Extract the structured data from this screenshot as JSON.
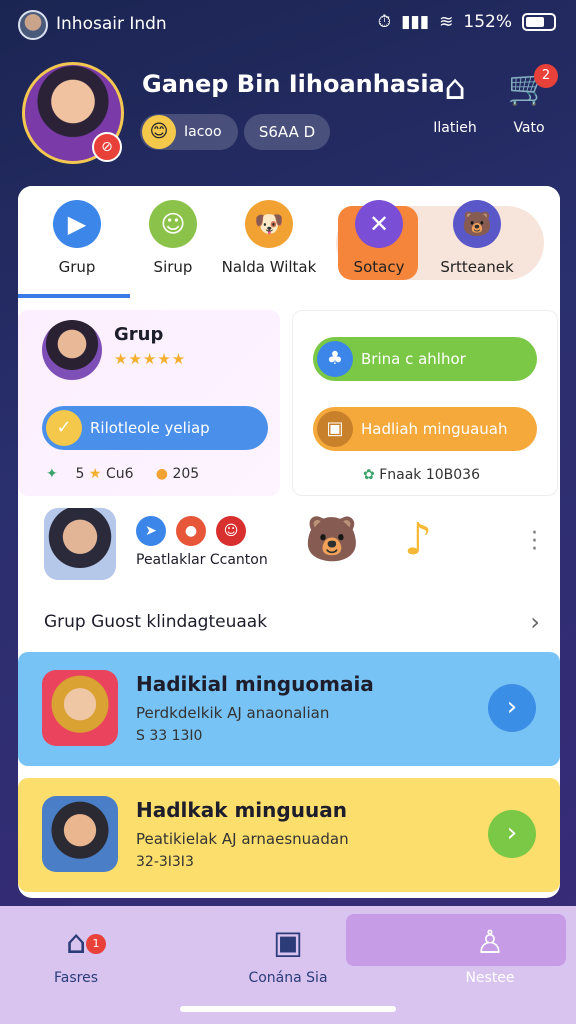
{
  "status_bar": {
    "title": "Inhosair Indn",
    "battery": "152%"
  },
  "header": {
    "app_title": "Ganep Bin Iihoanhasia",
    "coins": "Iacoo",
    "gems": "S6AA D",
    "home_label": "Ilatieh",
    "cart_label": "Vato",
    "cart_count": "2"
  },
  "tabs": [
    {
      "label": "Grup",
      "icon": "play-icon"
    },
    {
      "label": "Sirup",
      "icon": "chat-icon"
    },
    {
      "label": "Nalda Wiltak",
      "icon": "pet-icon"
    },
    {
      "label": "Sotacy",
      "icon": "cross-icon"
    },
    {
      "label": "Srtteanek",
      "icon": "bear-icon"
    }
  ],
  "group_panel": {
    "title": "Grup",
    "stars": "★★★★★",
    "button_label": "Rilotleole yeliap",
    "stat1": "5",
    "stat2": "Cu6",
    "stat3": "205"
  },
  "right_panel": {
    "button1_label": "Brina c ahlhor",
    "button2_label": "Hadliah minguauah",
    "stat": "Fnaak 10B036"
  },
  "friends": {
    "label": "Peatlaklar Ccanton"
  },
  "group_link": "Grup Guost klindagteuaak",
  "rewards": [
    {
      "title": "Hadikial minguomaia",
      "subtitle": "Perdkdelkik AJ anaonalian",
      "value": "S 33 13I0",
      "accent": "#78c3f5"
    },
    {
      "title": "Hadlkak minguuan",
      "subtitle": "Peatikielak AJ arnaesnuadan",
      "value": "32-3I3I3",
      "accent": "#fbde6c"
    }
  ],
  "bottom_nav": [
    {
      "label": "Fasres",
      "badge": "1"
    },
    {
      "label": "Conána Sia"
    },
    {
      "label": "Nestee"
    }
  ]
}
